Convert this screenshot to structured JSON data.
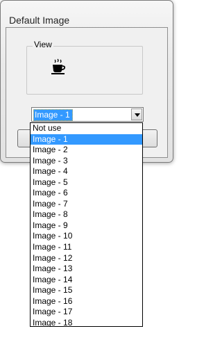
{
  "window": {
    "title": "Default Image"
  },
  "view_group": {
    "label": "View",
    "icon": "coffee-cup-icon"
  },
  "image_select": {
    "value": "Image - 1",
    "arrow_icon": "chevron-down-icon"
  },
  "dropdown": {
    "items": [
      "Not use",
      "Image - 1",
      "Image - 2",
      "Image - 3",
      "Image - 4",
      "Image - 5",
      "Image - 6",
      "Image - 7",
      "Image - 8",
      "Image - 9",
      "Image - 10",
      "Image - 11",
      "Image - 12",
      "Image - 13",
      "Image - 14",
      "Image - 15",
      "Image - 16",
      "Image - 17",
      "Image - 18"
    ],
    "selected_index": 1
  },
  "colors": {
    "selection": "#3399ff",
    "selection_text": "#ffffff"
  }
}
